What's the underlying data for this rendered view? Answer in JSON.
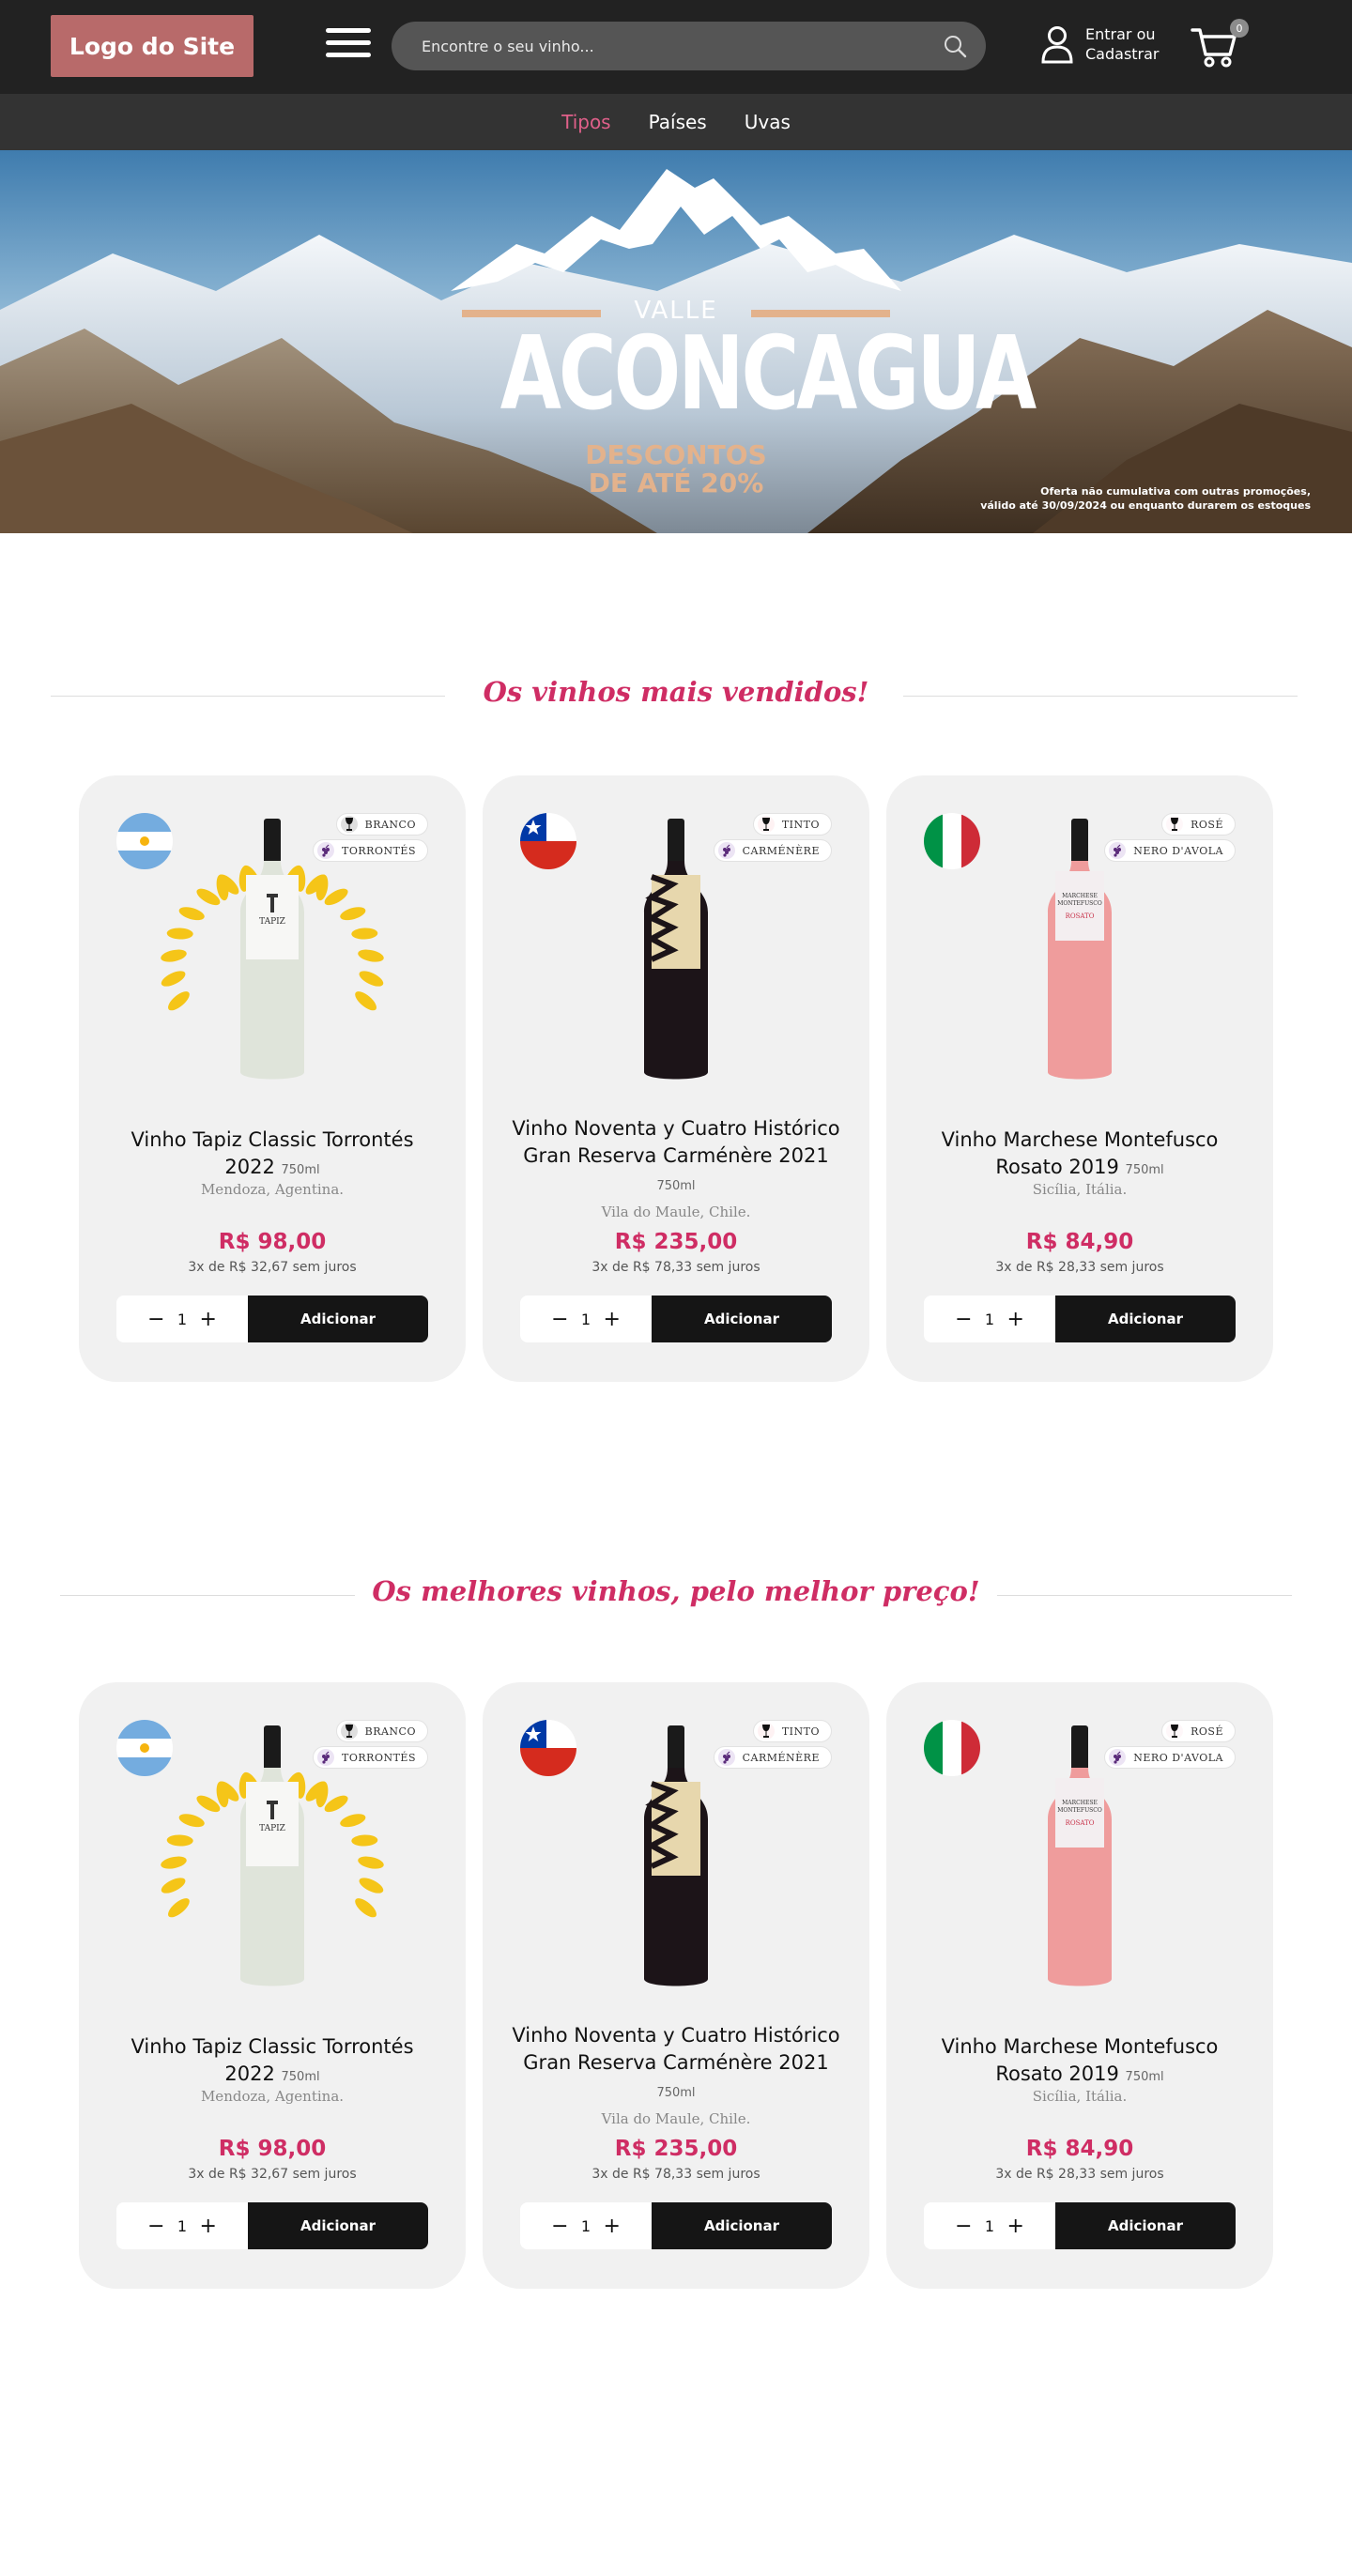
{
  "header": {
    "logo": "Logo do Site",
    "search_placeholder": "Encontre o seu vinho...",
    "account_line1": "Entrar ou",
    "account_line2": "Cadastrar",
    "cart_count": "0"
  },
  "nav": {
    "items": [
      {
        "label": "Tipos",
        "active": true
      },
      {
        "label": "Países",
        "active": false
      },
      {
        "label": "Uvas",
        "active": false
      }
    ]
  },
  "banner": {
    "valle": "VALLE",
    "aconcagua": "ACONCAGUA",
    "descontos_line1": "DESCONTOS",
    "descontos_line2": "DE ATÉ 20%",
    "oferta_line1": "Oferta não cumulativa com outras promoções,",
    "oferta_line2": "válido até 30/09/2024 ou enquanto durarem os estoques"
  },
  "sections": [
    {
      "title": "Os vinhos mais vendidos!",
      "products": [
        {
          "flag": "argentina",
          "type": "BRANCO",
          "type_color": "#111111",
          "grape": "TORRONTÉS",
          "wine": "white",
          "award": true,
          "name": "Vinho Tapiz Classic Torrontés 2022",
          "volume": "750ml",
          "origin": "Mendoza, Agentina.",
          "price": "R$ 98,00",
          "installments": "3x de R$ 32,67 sem juros",
          "qty": "1",
          "button": "Adicionar"
        },
        {
          "flag": "chile",
          "type": "TINTO",
          "type_color": "#f4a0a8",
          "grape": "CARMÉNÈRE",
          "wine": "red",
          "award": false,
          "name": "Vinho Noventa y Cuatro Histórico Gran Reserva Carménère 2021",
          "volume": "750ml",
          "origin": "Vila do Maule, Chile.",
          "price": "R$ 235,00",
          "installments": "3x de R$ 78,33 sem juros",
          "qty": "1",
          "button": "Adicionar"
        },
        {
          "flag": "italy",
          "type": "ROSÉ",
          "type_color": "#f5c2cf",
          "grape": "NERO D'AVOLA",
          "wine": "rose",
          "award": false,
          "name": "Vinho Marchese Montefusco Rosato 2019",
          "volume": "750ml",
          "origin": "Sicília, Itália.",
          "price": "R$ 84,90",
          "installments": "3x de R$ 28,33 sem juros",
          "qty": "1",
          "button": "Adicionar"
        }
      ]
    },
    {
      "title": "Os melhores vinhos, pelo melhor preço!",
      "products": [
        {
          "flag": "argentina",
          "type": "BRANCO",
          "type_color": "#111111",
          "grape": "TORRONTÉS",
          "wine": "white",
          "award": true,
          "name": "Vinho Tapiz Classic Torrontés 2022",
          "volume": "750ml",
          "origin": "Mendoza, Agentina.",
          "price": "R$ 98,00",
          "installments": "3x de R$ 32,67 sem juros",
          "qty": "1",
          "button": "Adicionar"
        },
        {
          "flag": "chile",
          "type": "TINTO",
          "type_color": "#f4a0a8",
          "grape": "CARMÉNÈRE",
          "wine": "red",
          "award": false,
          "name": "Vinho Noventa y Cuatro Histórico Gran Reserva Carménère 2021",
          "volume": "750ml",
          "origin": "Vila do Maule, Chile.",
          "price": "R$ 235,00",
          "installments": "3x de R$ 78,33 sem juros",
          "qty": "1",
          "button": "Adicionar"
        },
        {
          "flag": "italy",
          "type": "ROSÉ",
          "type_color": "#f5c2cf",
          "grape": "NERO D'AVOLA",
          "wine": "rose",
          "award": false,
          "name": "Vinho Marchese Montefusco Rosato 2019",
          "volume": "750ml",
          "origin": "Sicília, Itália.",
          "price": "R$ 84,90",
          "installments": "3x de R$ 28,33 sem juros",
          "qty": "1",
          "button": "Adicionar"
        }
      ]
    }
  ],
  "colors": {
    "accent": "#cf2d64",
    "header_bg": "#222222",
    "nav_bg": "#333333",
    "logo_bg": "#b86a6a",
    "card_bg": "#f1f1f1",
    "banner_gold": "#e3b28c"
  }
}
